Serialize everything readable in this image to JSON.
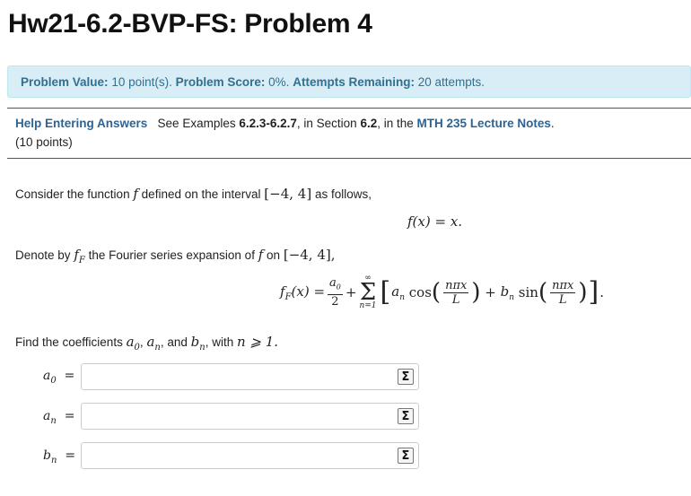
{
  "page": {
    "title": "Hw21-6.2-BVP-FS: Problem 4"
  },
  "problem_info": {
    "value_label": "Problem Value:",
    "value_text": "10 point(s).",
    "score_label": "Problem Score:",
    "score_text": "0%.",
    "attempts_label": "Attempts Remaining:",
    "attempts_text": "20 attempts."
  },
  "help": {
    "link": "Help Entering Answers",
    "text_1": "See Examples",
    "examples": "6.2.3-6.2.7",
    "text_2": ", in Section",
    "section": "6.2",
    "text_3": ", in the",
    "notes": "MTH 235 Lecture Notes",
    "text_4": ".",
    "points": "(10 points)"
  },
  "problem": {
    "intro_1": "Consider the function",
    "intro_f": "f",
    "intro_2": "defined on the interval",
    "interval": "[−4, 4]",
    "intro_3": "as follows,",
    "equation": "f(x) = x.",
    "denote_1": "Denote by",
    "denote_fF": "f",
    "denote_sub": "F",
    "denote_2": "the Fourier series expansion of",
    "denote_f": "f",
    "denote_3": "on",
    "denote_interval": "[−4, 4],",
    "find_1": "Find the coefficients",
    "find_a0": "a",
    "find_2": ",",
    "find_an": "a",
    "find_3": ", and",
    "find_bn": "b",
    "find_4": ", with",
    "find_cond": "n ⩾ 1."
  },
  "answers": [
    {
      "label": "a",
      "sub": "0",
      "value": "",
      "button": "Σ"
    },
    {
      "label": "a",
      "sub": "n",
      "value": "",
      "button": "Σ"
    },
    {
      "label": "b",
      "sub": "n",
      "value": "",
      "button": "Σ"
    }
  ]
}
